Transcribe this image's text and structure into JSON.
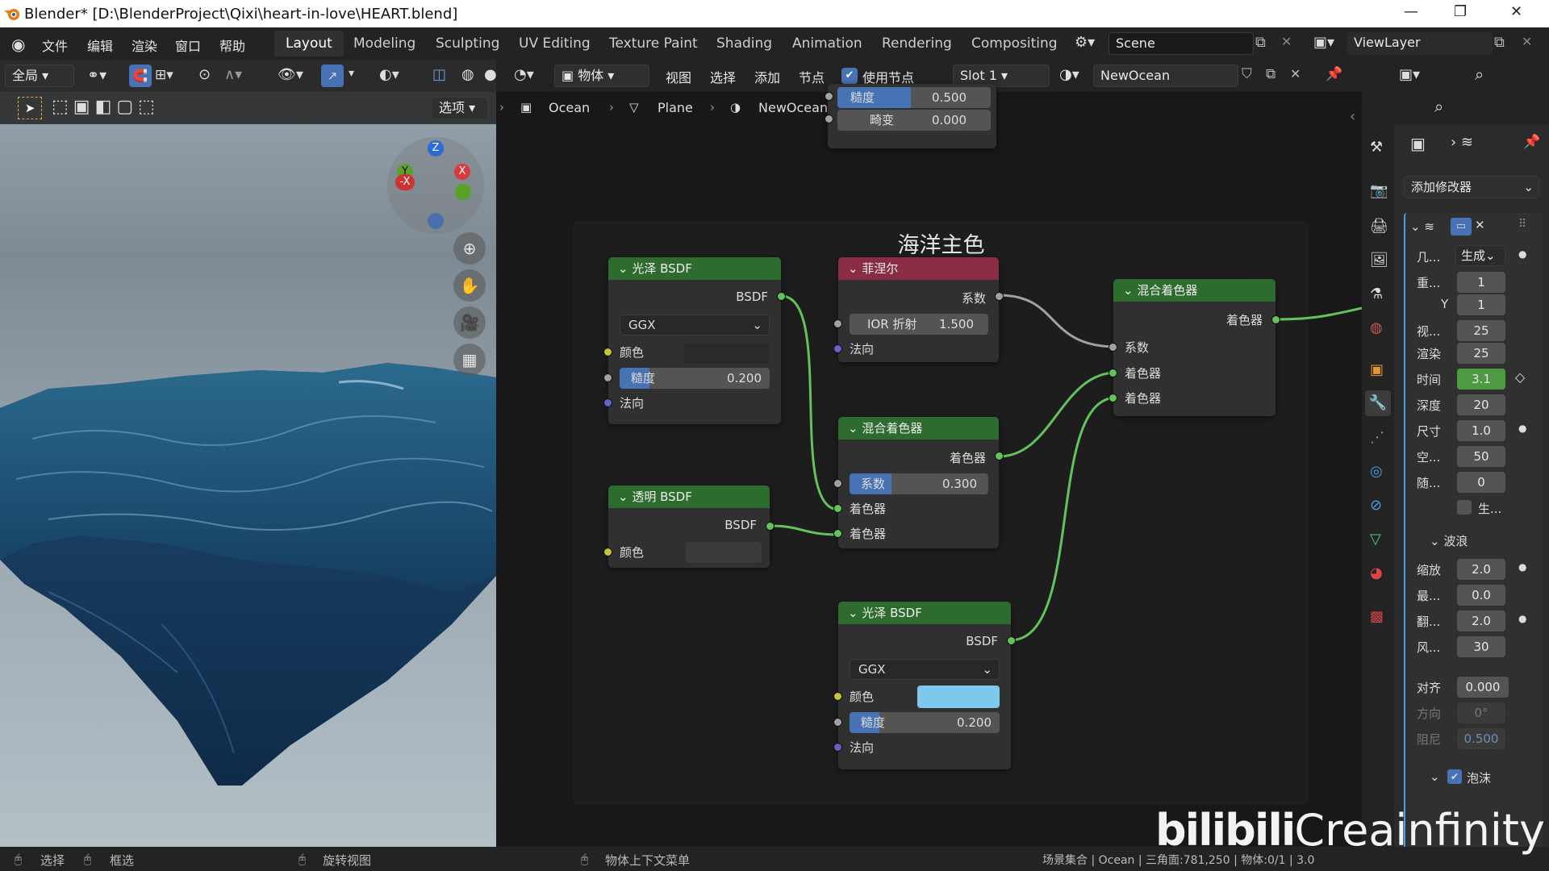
{
  "window": {
    "title": "Blender* [D:\\BlenderProject\\Qixi\\heart-in-love\\HEART.blend]"
  },
  "menu": [
    "文件",
    "编辑",
    "渲染",
    "窗口",
    "帮助"
  ],
  "workspaces": [
    "Layout",
    "Modeling",
    "Sculpting",
    "UV Editing",
    "Texture Paint",
    "Shading",
    "Animation",
    "Rendering",
    "Compositing"
  ],
  "scene": {
    "name": "Scene",
    "view_layer": "ViewLayer"
  },
  "viewport": {
    "mode": "全局",
    "options": "选项"
  },
  "node_editor": {
    "object_mode": "物体",
    "menus": [
      "视图",
      "选择",
      "添加",
      "节点"
    ],
    "use_nodes_label": "使用节点",
    "slot": "Slot 1",
    "material": "NewOcean",
    "breadcrumb": [
      "Ocean",
      "Plane",
      "NewOcean"
    ],
    "top_node": {
      "f1_label": "糙度",
      "f1_value": "0.500",
      "f2_label": "畸变",
      "f2_value": "0.000"
    },
    "frame_title": "海洋主色",
    "glossy1": {
      "title": "光泽 BSDF",
      "out": "BSDF",
      "dist": "GGX",
      "color": "颜色",
      "rough_label": "糙度",
      "rough": "0.200",
      "rough_fill": 0.2,
      "normal": "法向"
    },
    "fresnel": {
      "title": "菲涅尔",
      "out": "系数",
      "ior_label": "IOR 折射",
      "ior": "1.500",
      "normal": "法向"
    },
    "mix1": {
      "title": "混合着色器",
      "out": "着色器",
      "fac_label": "系数",
      "fac": "0.300",
      "fac_fill": 0.3,
      "in1": "着色器",
      "in2": "着色器"
    },
    "transparent": {
      "title": "透明 BSDF",
      "out": "BSDF",
      "color": "颜色"
    },
    "glossy2": {
      "title": "光泽 BSDF",
      "out": "BSDF",
      "dist": "GGX",
      "color": "颜色",
      "color_hex": "#7ec8f0",
      "rough_label": "糙度",
      "rough": "0.200",
      "rough_fill": 0.2,
      "normal": "法向"
    },
    "mix2": {
      "title": "混合着色器",
      "out": "着色器",
      "fac": "系数",
      "in1": "着色器",
      "in2": "着色器"
    }
  },
  "properties": {
    "add_modifier": "添加修改器",
    "rows": [
      {
        "label": "几...",
        "value": "生成"
      },
      {
        "label": "重...",
        "value": "1"
      },
      {
        "label": "Y",
        "value": "1"
      },
      {
        "label": "视...",
        "value": "25"
      },
      {
        "label": "渲染",
        "value": "25"
      },
      {
        "label": "时间",
        "value": "3.1"
      },
      {
        "label": "深度",
        "value": "20"
      },
      {
        "label": "尺寸",
        "value": "1.0"
      },
      {
        "label": "空...",
        "value": "50"
      },
      {
        "label": "随...",
        "value": "0"
      }
    ],
    "gen_checkbox": "生...",
    "waves_section": "波浪",
    "waves_rows": [
      {
        "label": "缩放",
        "value": "2.0"
      },
      {
        "label": "最...",
        "value": "0.0"
      },
      {
        "label": "翻...",
        "value": "2.0"
      },
      {
        "label": "风...",
        "value": "30"
      }
    ],
    "align": {
      "label": "对齐",
      "value": "0.000"
    },
    "direction": {
      "label": "方向",
      "value": "0°"
    },
    "damping": {
      "label": "阻尼",
      "value": "0.500"
    },
    "foam": "泡沫"
  },
  "status": {
    "select": "选择",
    "box_select": "框选",
    "rotate_view": "旋转视图",
    "context_menu": "物体上下文菜单",
    "right": "场景集合 | Ocean | 三角面:781,250 | 物体:0/1 | 3.0"
  },
  "watermark": "Creainfinity"
}
